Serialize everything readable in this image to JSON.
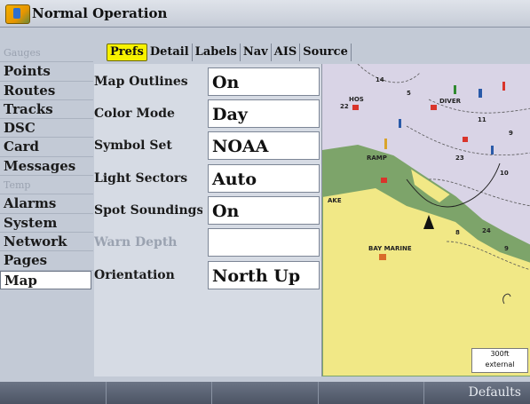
{
  "app": {
    "title": "Normal Operation"
  },
  "sidebar": {
    "items": [
      {
        "label": "Gauges",
        "state": "dim"
      },
      {
        "label": "Points",
        "state": "normal"
      },
      {
        "label": "Routes",
        "state": "normal"
      },
      {
        "label": "Tracks",
        "state": "normal"
      },
      {
        "label": "DSC",
        "state": "normal"
      },
      {
        "label": "Card",
        "state": "normal"
      },
      {
        "label": "Messages",
        "state": "normal"
      },
      {
        "label": "Temp",
        "state": "dim"
      },
      {
        "label": "Alarms",
        "state": "normal"
      },
      {
        "label": "System",
        "state": "normal"
      },
      {
        "label": "Network",
        "state": "normal"
      },
      {
        "label": "Pages",
        "state": "normal"
      },
      {
        "label": "Map",
        "state": "selected"
      }
    ]
  },
  "tabs": [
    {
      "label": "Prefs",
      "active": true
    },
    {
      "label": "Detail",
      "active": false
    },
    {
      "label": "Labels",
      "active": false
    },
    {
      "label": "Nav",
      "active": false
    },
    {
      "label": "AIS",
      "active": false
    },
    {
      "label": "Source",
      "active": false
    }
  ],
  "settings": [
    {
      "label": "Map Outlines",
      "value": "On",
      "enabled": true
    },
    {
      "label": "Color Mode",
      "value": "Day",
      "enabled": true
    },
    {
      "label": "Symbol Set",
      "value": "NOAA",
      "enabled": true
    },
    {
      "label": "Light Sectors",
      "value": "Auto",
      "enabled": true
    },
    {
      "label": "Spot Soundings",
      "value": "On",
      "enabled": true
    },
    {
      "label": "Warn Depth",
      "value": "",
      "enabled": false
    },
    {
      "label": "Orientation",
      "value": "North Up",
      "enabled": true
    }
  ],
  "map": {
    "labels": {
      "diver": "DIVER",
      "ramp": "RAMP",
      "bay_marine": "BAY MARINE",
      "hos": "HOS",
      "ake": "AKE"
    },
    "scale": {
      "distance": "300ft",
      "source": "external"
    },
    "colors": {
      "water": "#d9d4e6",
      "land": "#f1e886",
      "shore": "#7da46a"
    }
  },
  "softkeys": [
    {
      "label": ""
    },
    {
      "label": ""
    },
    {
      "label": ""
    },
    {
      "label": ""
    },
    {
      "label": "Defaults"
    }
  ]
}
